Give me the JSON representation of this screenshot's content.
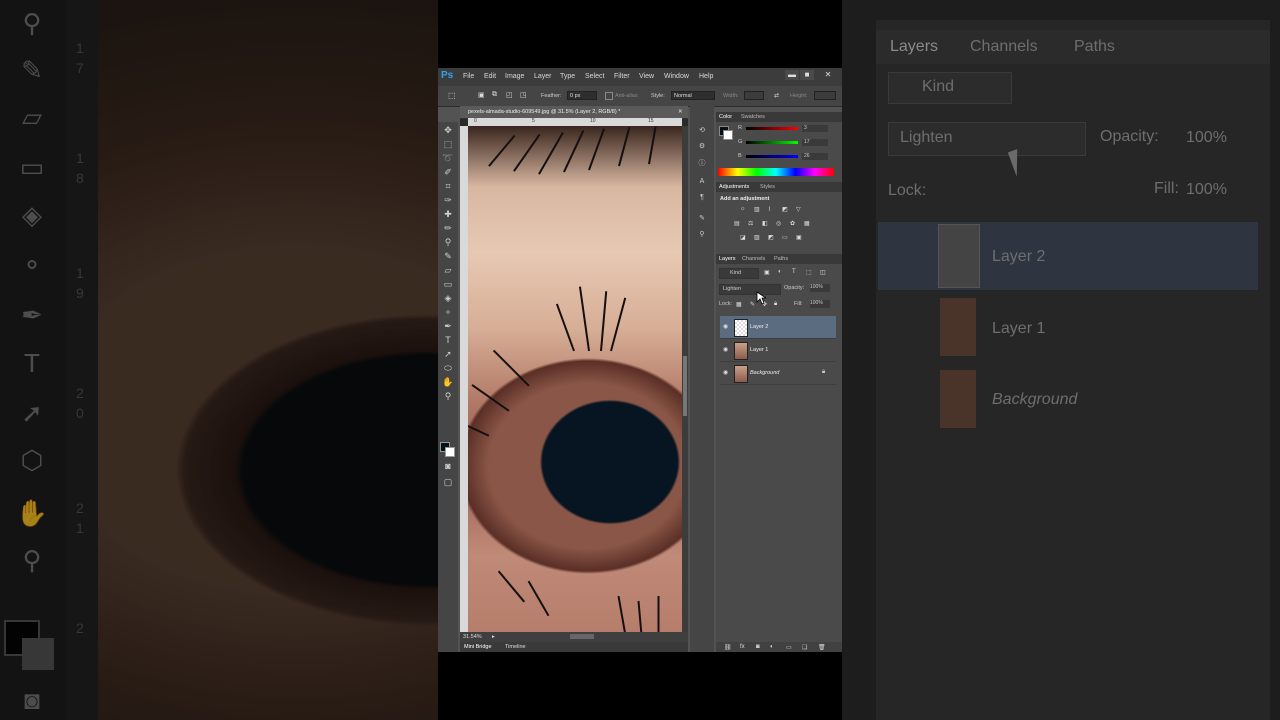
{
  "app": {
    "logo": "Ps",
    "menu": [
      "File",
      "Edit",
      "Image",
      "Layer",
      "Type",
      "Select",
      "Filter",
      "View",
      "Window",
      "Help"
    ],
    "window_controls": [
      "▬",
      "■",
      "✕"
    ]
  },
  "options_bar": {
    "feather_label": "Feather:",
    "feather_value": "0 px",
    "anti_alias_label": "Anti-alias",
    "style_label": "Style:",
    "style_value": "Normal",
    "width_label": "Width:",
    "height_label": "Height:"
  },
  "document": {
    "tab_title": "pexels-almada-studio-609549.jpg @ 31.5% (Layer 2, RGB/8) *",
    "zoom": "31.54%",
    "ruler_marks": [
      "0",
      "5",
      "10",
      "15"
    ]
  },
  "bottom_tabs": [
    "Mini Bridge",
    "Timeline"
  ],
  "color_panel": {
    "tabs": [
      "Color",
      "Swatches"
    ],
    "r_label": "R",
    "r_value": "3",
    "g_label": "G",
    "g_value": "17",
    "b_label": "B",
    "b_value": "26",
    "foreground": "#03111a"
  },
  "adjustments_panel": {
    "tabs": [
      "Adjustments",
      "Styles"
    ],
    "heading": "Add an adjustment"
  },
  "layers_panel": {
    "tabs": [
      "Layers",
      "Channels",
      "Paths"
    ],
    "filter_kind": "Kind",
    "blend_mode": "Lighten",
    "opacity_label": "Opacity:",
    "opacity_value": "100%",
    "lock_label": "Lock:",
    "fill_label": "Fill:",
    "fill_value": "100%",
    "layers": [
      {
        "name": "Layer 2",
        "selected": true
      },
      {
        "name": "Layer 1",
        "selected": false
      },
      {
        "name": "Background",
        "selected": false,
        "locked": true
      }
    ]
  },
  "background_zoom": {
    "tabs": [
      "Layers",
      "Channels",
      "Paths"
    ],
    "filter_kind": "Kind",
    "blend_mode": "Lighten",
    "opacity_label": "Opacity:",
    "opacity_value": "100%",
    "lock_label": "Lock:",
    "fill_label": "Fill:",
    "fill_value": "100%",
    "layer_2": "Layer 2",
    "layer_1": "Layer 1",
    "background": "Background",
    "ruler_digits": [
      "1",
      "7",
      "1",
      "8",
      "1",
      "9",
      "2",
      "0",
      "2",
      "1",
      "2"
    ]
  }
}
